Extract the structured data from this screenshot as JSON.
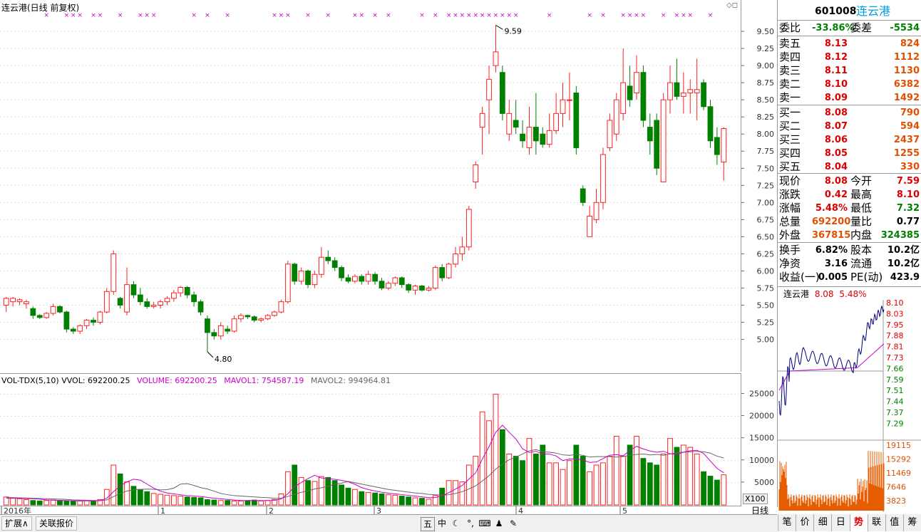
{
  "main_title": "连云港(日线 前复权)",
  "max_label": "9.59",
  "min_label": "4.80",
  "price_axis": [
    "9.50",
    "9.25",
    "9.00",
    "8.75",
    "8.50",
    "8.25",
    "8.00",
    "7.75",
    "7.50",
    "7.25",
    "7.00",
    "6.75",
    "6.50",
    "6.25",
    "6.00",
    "5.75",
    "5.50",
    "5.25",
    "5.00"
  ],
  "vol_legend": {
    "name": "VOL-TDX(5,10)",
    "vvol": "VVOL: 692200.25",
    "volume": "VOLUME: 692200.25",
    "mavol1": "MAVOL1: 754587.19",
    "mavol2": "MAVOL2: 994964.81"
  },
  "vol_axis": [
    "25000",
    "20000",
    "15000",
    "10000",
    "5000"
  ],
  "vol_unit": "X100",
  "date_axis": [
    "2016年",
    "1",
    "2",
    "3",
    "4",
    "5"
  ],
  "period_label": "日线",
  "quote": {
    "code": "601008",
    "name": "连云港",
    "weibi_label": "委比",
    "weibi": "-33.86%",
    "weicha_label": "委差",
    "weicha": "-5534",
    "asks": [
      {
        "label": "卖五",
        "price": "8.13",
        "vol": "824"
      },
      {
        "label": "卖四",
        "price": "8.12",
        "vol": "1112"
      },
      {
        "label": "卖三",
        "price": "8.11",
        "vol": "1130"
      },
      {
        "label": "卖二",
        "price": "8.10",
        "vol": "6382"
      },
      {
        "label": "卖一",
        "price": "8.09",
        "vol": "1492"
      }
    ],
    "bids": [
      {
        "label": "买一",
        "price": "8.08",
        "vol": "790"
      },
      {
        "label": "买二",
        "price": "8.07",
        "vol": "594"
      },
      {
        "label": "买三",
        "price": "8.06",
        "vol": "2437"
      },
      {
        "label": "买四",
        "price": "8.05",
        "vol": "1255"
      },
      {
        "label": "买五",
        "price": "8.04",
        "vol": "330"
      }
    ],
    "stats": [
      {
        "l1": "现价",
        "v1": "8.08",
        "l2": "今开",
        "v2": "7.59"
      },
      {
        "l1": "涨跌",
        "v1": "0.42",
        "l2": "最高",
        "v2": "8.10"
      },
      {
        "l1": "涨幅",
        "v1": "5.48%",
        "l2": "最低",
        "v2": "7.32"
      },
      {
        "l1": "总量",
        "v1": "692200",
        "l2": "量比",
        "v2": "0.77"
      },
      {
        "l1": "外盘",
        "v1": "367815",
        "l2": "内盘",
        "v2": "324385"
      }
    ],
    "stats2": [
      {
        "l1": "换手",
        "v1": "6.82%",
        "l2": "股本",
        "v2": "10.2亿"
      },
      {
        "l1": "净资",
        "v1": "3.16",
        "l2": "流通",
        "v2": "10.2亿"
      },
      {
        "l1": "收益(一)",
        "v1": "0.005",
        "l2": "PE(动)",
        "v2": "423.9"
      }
    ]
  },
  "mini": {
    "title": "连云港",
    "price": "8.08",
    "pct": "5.48%",
    "price_axis": [
      "8.10",
      "8.03",
      "7.95",
      "7.88",
      "7.81",
      "7.73",
      "7.66",
      "7.59",
      "7.51",
      "7.44",
      "7.37",
      "7.29"
    ],
    "vol_axis": [
      "19115",
      "15292",
      "11469",
      "7646",
      "3823"
    ]
  },
  "tabs": [
    "笔",
    "价",
    "细",
    "日",
    "势",
    "联",
    "值",
    "筹"
  ],
  "active_tab": "势",
  "bottom_buttons": {
    "expand": "扩展∧",
    "related": "关联报价"
  },
  "colors": {
    "up": "#ff2020",
    "down": "#008000",
    "ma1": "#cc00cc",
    "ma2": "#666666",
    "mini_line": "#000080",
    "avg": "#cc00cc",
    "mini_vol": "#e65c00"
  },
  "chart_data": {
    "type": "candlestick",
    "title": "连云港(日线 前复权)",
    "ylim": [
      4.6,
      9.75
    ],
    "candles": [
      [
        5.5,
        5.6,
        5.4,
        5.62
      ],
      [
        5.55,
        5.6,
        5.48,
        5.62
      ],
      [
        5.55,
        5.58,
        5.5,
        5.6
      ],
      [
        5.52,
        5.55,
        5.45,
        5.58
      ],
      [
        5.45,
        5.35,
        5.3,
        5.48
      ],
      [
        5.35,
        5.32,
        5.3,
        5.37
      ],
      [
        5.32,
        5.38,
        5.3,
        5.4
      ],
      [
        5.38,
        5.48,
        5.35,
        5.52
      ],
      [
        5.48,
        5.4,
        5.38,
        5.5
      ],
      [
        5.4,
        5.15,
        5.1,
        5.42
      ],
      [
        5.15,
        5.12,
        5.08,
        5.18
      ],
      [
        5.12,
        5.2,
        5.08,
        5.22
      ],
      [
        5.2,
        5.28,
        5.15,
        5.3
      ],
      [
        5.28,
        5.25,
        5.2,
        5.32
      ],
      [
        5.25,
        5.4,
        5.22,
        5.42
      ],
      [
        5.4,
        5.7,
        5.38,
        5.75
      ],
      [
        5.7,
        6.25,
        5.65,
        6.3
      ],
      [
        5.6,
        5.5,
        5.45,
        5.62
      ],
      [
        5.4,
        5.8,
        5.35,
        6.05
      ],
      [
        5.8,
        5.65,
        5.6,
        5.85
      ],
      [
        5.65,
        5.55,
        5.5,
        5.75
      ],
      [
        5.55,
        5.48,
        5.45,
        5.6
      ],
      [
        5.48,
        5.5,
        5.45,
        5.55
      ],
      [
        5.5,
        5.55,
        5.45,
        5.58
      ],
      [
        5.55,
        5.6,
        5.5,
        5.63
      ],
      [
        5.6,
        5.68,
        5.55,
        5.72
      ],
      [
        5.68,
        5.76,
        5.62,
        5.78
      ],
      [
        5.76,
        5.65,
        5.6,
        5.78
      ],
      [
        5.65,
        5.55,
        5.48,
        5.7
      ],
      [
        5.55,
        5.4,
        5.35,
        5.58
      ],
      [
        5.3,
        5.1,
        4.82,
        5.35
      ],
      [
        5.1,
        5.05,
        5.0,
        5.15
      ],
      [
        5.05,
        5.2,
        5.0,
        5.25
      ],
      [
        5.15,
        5.12,
        5.08,
        5.2
      ],
      [
        5.12,
        5.3,
        5.1,
        5.35
      ],
      [
        5.3,
        5.35,
        5.25,
        5.38
      ],
      [
        5.35,
        5.33,
        5.3,
        5.36
      ],
      [
        5.33,
        5.28,
        5.25,
        5.35
      ],
      [
        5.28,
        5.3,
        5.25,
        5.32
      ],
      [
        5.3,
        5.35,
        5.28,
        5.37
      ],
      [
        5.35,
        5.4,
        5.33,
        5.42
      ],
      [
        5.4,
        5.55,
        5.38,
        5.58
      ],
      [
        5.55,
        6.1,
        5.52,
        6.15
      ],
      [
        6.1,
        5.85,
        5.8,
        6.12
      ],
      [
        5.85,
        6.0,
        5.8,
        6.05
      ],
      [
        6.0,
        5.8,
        5.75,
        6.02
      ],
      [
        5.8,
        5.95,
        5.75,
        6.0
      ],
      [
        5.95,
        6.2,
        5.9,
        6.35
      ],
      [
        6.2,
        6.15,
        6.1,
        6.3
      ],
      [
        6.15,
        6.05,
        6.0,
        6.2
      ],
      [
        6.05,
        5.9,
        5.85,
        6.08
      ],
      [
        5.9,
        5.85,
        5.82,
        5.95
      ],
      [
        5.85,
        5.92,
        5.82,
        5.95
      ],
      [
        5.92,
        5.85,
        5.8,
        5.95
      ],
      [
        5.85,
        5.95,
        5.8,
        6.0
      ],
      [
        5.95,
        5.85,
        5.8,
        5.98
      ],
      [
        5.85,
        5.75,
        5.72,
        5.9
      ],
      [
        5.75,
        5.82,
        5.72,
        5.85
      ],
      [
        5.82,
        5.9,
        5.78,
        5.92
      ],
      [
        5.9,
        5.8,
        5.75,
        5.92
      ],
      [
        5.8,
        5.72,
        5.68,
        5.82
      ],
      [
        5.72,
        5.78,
        5.65,
        5.8
      ],
      [
        5.78,
        5.72,
        5.7,
        5.8
      ],
      [
        5.72,
        5.75,
        5.7,
        5.78
      ],
      [
        5.75,
        6.05,
        5.72,
        6.08
      ],
      [
        6.05,
        5.9,
        5.85,
        6.1
      ],
      [
        5.9,
        6.1,
        5.88,
        6.12
      ],
      [
        6.1,
        6.25,
        6.05,
        6.35
      ],
      [
        6.25,
        6.35,
        6.15,
        6.5
      ],
      [
        6.35,
        6.9,
        6.3,
        6.95
      ],
      [
        7.3,
        7.55,
        7.2,
        7.6
      ],
      [
        8.1,
        8.3,
        7.7,
        8.4
      ],
      [
        8.5,
        8.8,
        8.0,
        9.0
      ],
      [
        9.0,
        9.2,
        8.9,
        9.59
      ],
      [
        8.9,
        8.3,
        8.2,
        9.0
      ],
      [
        8.0,
        8.3,
        7.9,
        8.5
      ],
      [
        8.2,
        8.1,
        8.0,
        8.5
      ],
      [
        8.0,
        7.9,
        7.8,
        8.2
      ],
      [
        7.8,
        8.1,
        7.7,
        8.4
      ],
      [
        8.1,
        7.9,
        7.7,
        8.6
      ],
      [
        8.0,
        7.85,
        7.8,
        8.1
      ],
      [
        7.85,
        8.05,
        7.8,
        8.3
      ],
      [
        8.05,
        8.3,
        8.0,
        8.6
      ],
      [
        8.3,
        8.5,
        8.1,
        8.75
      ],
      [
        8.5,
        8.5,
        8.2,
        8.9
      ],
      [
        8.6,
        7.8,
        7.7,
        8.7
      ],
      [
        7.2,
        7.0,
        6.95,
        7.25
      ],
      [
        6.5,
        6.8,
        6.5,
        6.95
      ],
      [
        6.75,
        7.0,
        6.7,
        7.2
      ],
      [
        7.0,
        7.7,
        6.9,
        7.8
      ],
      [
        7.8,
        8.2,
        7.75,
        8.3
      ],
      [
        8.0,
        8.5,
        7.9,
        8.6
      ],
      [
        8.3,
        8.75,
        8.2,
        9.25
      ],
      [
        8.7,
        8.5,
        8.4,
        9.0
      ],
      [
        8.6,
        8.9,
        8.5,
        9.15
      ],
      [
        8.9,
        8.2,
        8.1,
        9.0
      ],
      [
        8.1,
        7.9,
        7.7,
        8.3
      ],
      [
        8.2,
        7.5,
        7.4,
        8.3
      ],
      [
        7.3,
        8.5,
        7.3,
        8.6
      ],
      [
        8.5,
        8.75,
        8.3,
        9.0
      ],
      [
        8.75,
        8.55,
        8.5,
        9.1
      ],
      [
        8.55,
        8.6,
        8.3,
        8.9
      ],
      [
        8.6,
        8.65,
        8.3,
        8.8
      ],
      [
        8.6,
        8.65,
        8.2,
        9.1
      ],
      [
        8.75,
        8.4,
        8.35,
        8.8
      ],
      [
        8.4,
        7.9,
        7.8,
        8.5
      ],
      [
        7.95,
        7.7,
        7.55,
        8.1
      ],
      [
        7.59,
        8.08,
        7.32,
        8.1
      ]
    ],
    "volume": [
      1800,
      1600,
      1400,
      1200,
      1000,
      900,
      1000,
      1100,
      1000,
      900,
      800,
      900,
      1000,
      900,
      1200,
      3500,
      9000,
      7000,
      5200,
      4200,
      3500,
      3000,
      2600,
      2400,
      2200,
      2100,
      2000,
      1800,
      1700,
      1600,
      1200,
      1100,
      1000,
      1000,
      900,
      900,
      1000,
      1100,
      900,
      1000,
      1200,
      2500,
      7500,
      9000,
      6200,
      5500,
      5300,
      6400,
      6200,
      5500,
      4500,
      3800,
      3500,
      3000,
      2800,
      2700,
      2500,
      2300,
      2200,
      2000,
      1800,
      1600,
      1500,
      1300,
      2100,
      3800,
      5500,
      5500,
      5200,
      9000,
      11000,
      21000,
      19000,
      25000,
      17000,
      11500,
      11000,
      10000,
      15000,
      11500,
      13500,
      9500,
      9500,
      8000,
      10000,
      13500,
      11000,
      7500,
      9000,
      9500,
      11000,
      15500,
      11000,
      13500,
      15500,
      10500,
      9500,
      9000,
      11500,
      15000,
      13000,
      13500,
      13000,
      11500,
      7500,
      6500,
      5600,
      6800
    ],
    "mavol1": [
      1500,
      1500,
      1500,
      1450,
      1400,
      1300,
      1150,
      1080,
      1020,
      980,
      950,
      920,
      930,
      920,
      940,
      1500,
      3000,
      4300,
      5200,
      5800,
      5600,
      4700,
      3800,
      3100,
      2700,
      2500,
      2300,
      2100,
      2000,
      1900,
      1700,
      1500,
      1380,
      1250,
      1100,
      1000,
      980,
      1000,
      980,
      990,
      1040,
      1340,
      2530,
      4130,
      5080,
      5930,
      6710,
      6080,
      5920,
      5780,
      5540,
      5240,
      4660,
      3900,
      3480,
      3160,
      2880,
      2660,
      2500,
      2340,
      2160,
      1980,
      1820,
      1640,
      1660,
      2060,
      2760,
      3580,
      4400,
      5820,
      7240,
      10340,
      13160,
      16400,
      18000,
      16400,
      14900,
      12660,
      11840,
      12100,
      11500,
      11480,
      11060,
      10000,
      10360,
      10400,
      10100,
      9600,
      9700,
      10460,
      11240,
      11340,
      11100,
      12260,
      13240,
      12640,
      12180,
      11900,
      12100,
      11540,
      11380,
      11900,
      12240,
      12340,
      11620,
      9920,
      8260,
      7240
    ],
    "mavol2": [
      1700,
      1650,
      1600,
      1550,
      1500,
      1450,
      1400,
      1350,
      1300,
      1250,
      1150,
      1100,
      1050,
      1000,
      980,
      1120,
      1880,
      2600,
      3140,
      3420,
      3520,
      3570,
      3540,
      3400,
      3460,
      3800,
      4700,
      4800,
      4400,
      3900,
      3600,
      3100,
      2600,
      2300,
      2100,
      2000,
      1900,
      1800,
      1700,
      1650,
      1500,
      1500,
      1900,
      2400,
      2850,
      3200,
      3600,
      3880,
      4200,
      4700,
      4900,
      5300,
      5000,
      4700,
      4400,
      4100,
      3800,
      3500,
      3300,
      3100,
      2900,
      2700,
      2600,
      2400,
      2300,
      2200,
      2300,
      2600,
      3000,
      3600,
      4300,
      5400,
      6600,
      8100,
      9200,
      10200,
      10800,
      11500,
      12200,
      12500,
      12000,
      11900,
      11700,
      11300,
      11200,
      11400,
      11200,
      10800,
      10900,
      10900,
      10900,
      10800,
      10900,
      11200,
      11400,
      11500,
      11300,
      11400,
      11200,
      11500,
      11800,
      11900,
      12000,
      12100,
      12000,
      11700,
      11000,
      10600
    ]
  }
}
